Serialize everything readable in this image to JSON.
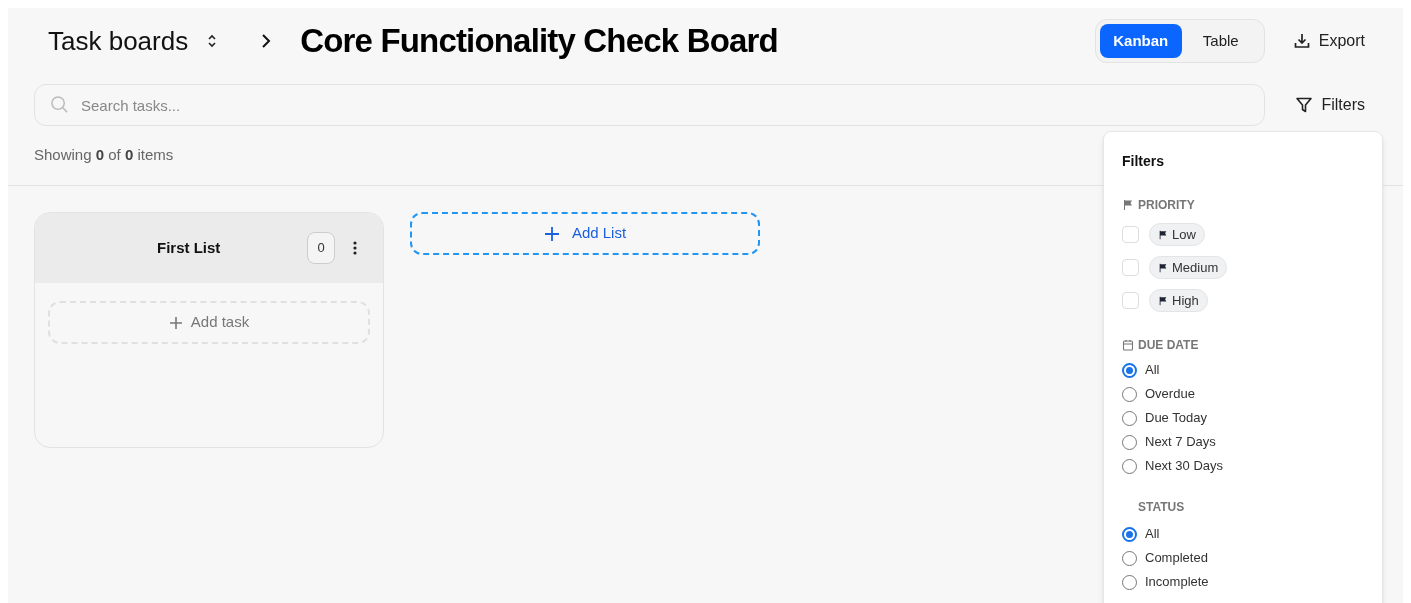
{
  "breadcrumb": {
    "parent": "Task boards",
    "title": "Core Functionality Check Board"
  },
  "view_toggle": [
    {
      "label": "Kanban",
      "selected": true
    },
    {
      "label": "Table",
      "selected": false
    }
  ],
  "export_button": "Export",
  "search": {
    "placeholder": "Search tasks..."
  },
  "filters_button": "Filters",
  "summary": "Showing **0** of **0** items",
  "lists": [
    {
      "title": "First List",
      "count": "0",
      "add_task": "Add task"
    }
  ],
  "add_list": "Add List",
  "filters_panel": {
    "title": "Filters",
    "priority": {
      "heading": "PRIORITY",
      "options": [
        {
          "label": "Low",
          "checked": false
        },
        {
          "label": "Medium",
          "checked": false
        },
        {
          "label": "High",
          "checked": false
        }
      ]
    },
    "due_date": {
      "heading": "DUE DATE",
      "options": [
        {
          "label": "All",
          "selected": true
        },
        {
          "label": "Overdue",
          "selected": false
        },
        {
          "label": "Due Today",
          "selected": false
        },
        {
          "label": "Next 7 Days",
          "selected": false
        },
        {
          "label": "Next 30 Days",
          "selected": false
        }
      ]
    },
    "status": {
      "heading": "STATUS",
      "options": [
        {
          "label": "All",
          "selected": true
        },
        {
          "label": "Completed",
          "selected": false
        },
        {
          "label": "Incomplete",
          "selected": false
        }
      ]
    }
  }
}
